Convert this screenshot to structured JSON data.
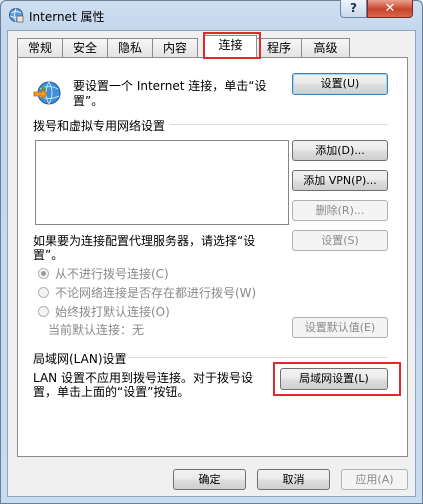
{
  "window": {
    "title": "Internet 属性",
    "help_label": "?",
    "close_label": "✕"
  },
  "tabs": [
    {
      "label": "常规"
    },
    {
      "label": "安全"
    },
    {
      "label": "隐私"
    },
    {
      "label": "内容"
    },
    {
      "label": "连接"
    },
    {
      "label": "程序"
    },
    {
      "label": "高级"
    }
  ],
  "setup": {
    "text_line1": "要设置一个 Internet 连接，单击“设",
    "text_line2": "置”。",
    "button": "设置(U)"
  },
  "dialup": {
    "group_title": "拨号和虚拟专用网络设置",
    "add_button": "添加(D)...",
    "add_vpn_button": "添加 VPN(P)...",
    "remove_button": "删除(R)...",
    "proxy_text_line1": "如果要为连接配置代理服务器，请选择“设",
    "proxy_text_line2": "置”。",
    "settings_button": "设置(S)",
    "radio_never": "从不进行拨号连接(C)",
    "radio_when_no_network": "不论网络连接是否存在都进行拨号(W)",
    "radio_always": "始终拨打默认连接(O)",
    "current_default_label": "当前默认连接：",
    "current_default_value": "无",
    "set_default_button": "设置默认值(E)"
  },
  "lan": {
    "group_title": "局域网(LAN)设置",
    "text_line1": "LAN 设置不应用到拨号连接。对于拨号设",
    "text_line2": "置，单击上面的“设置”按钮。",
    "button": "局域网设置(L)"
  },
  "footer": {
    "ok": "确定",
    "cancel": "取消",
    "apply": "应用(A)"
  },
  "colors": {
    "highlight": "#e0292b"
  }
}
